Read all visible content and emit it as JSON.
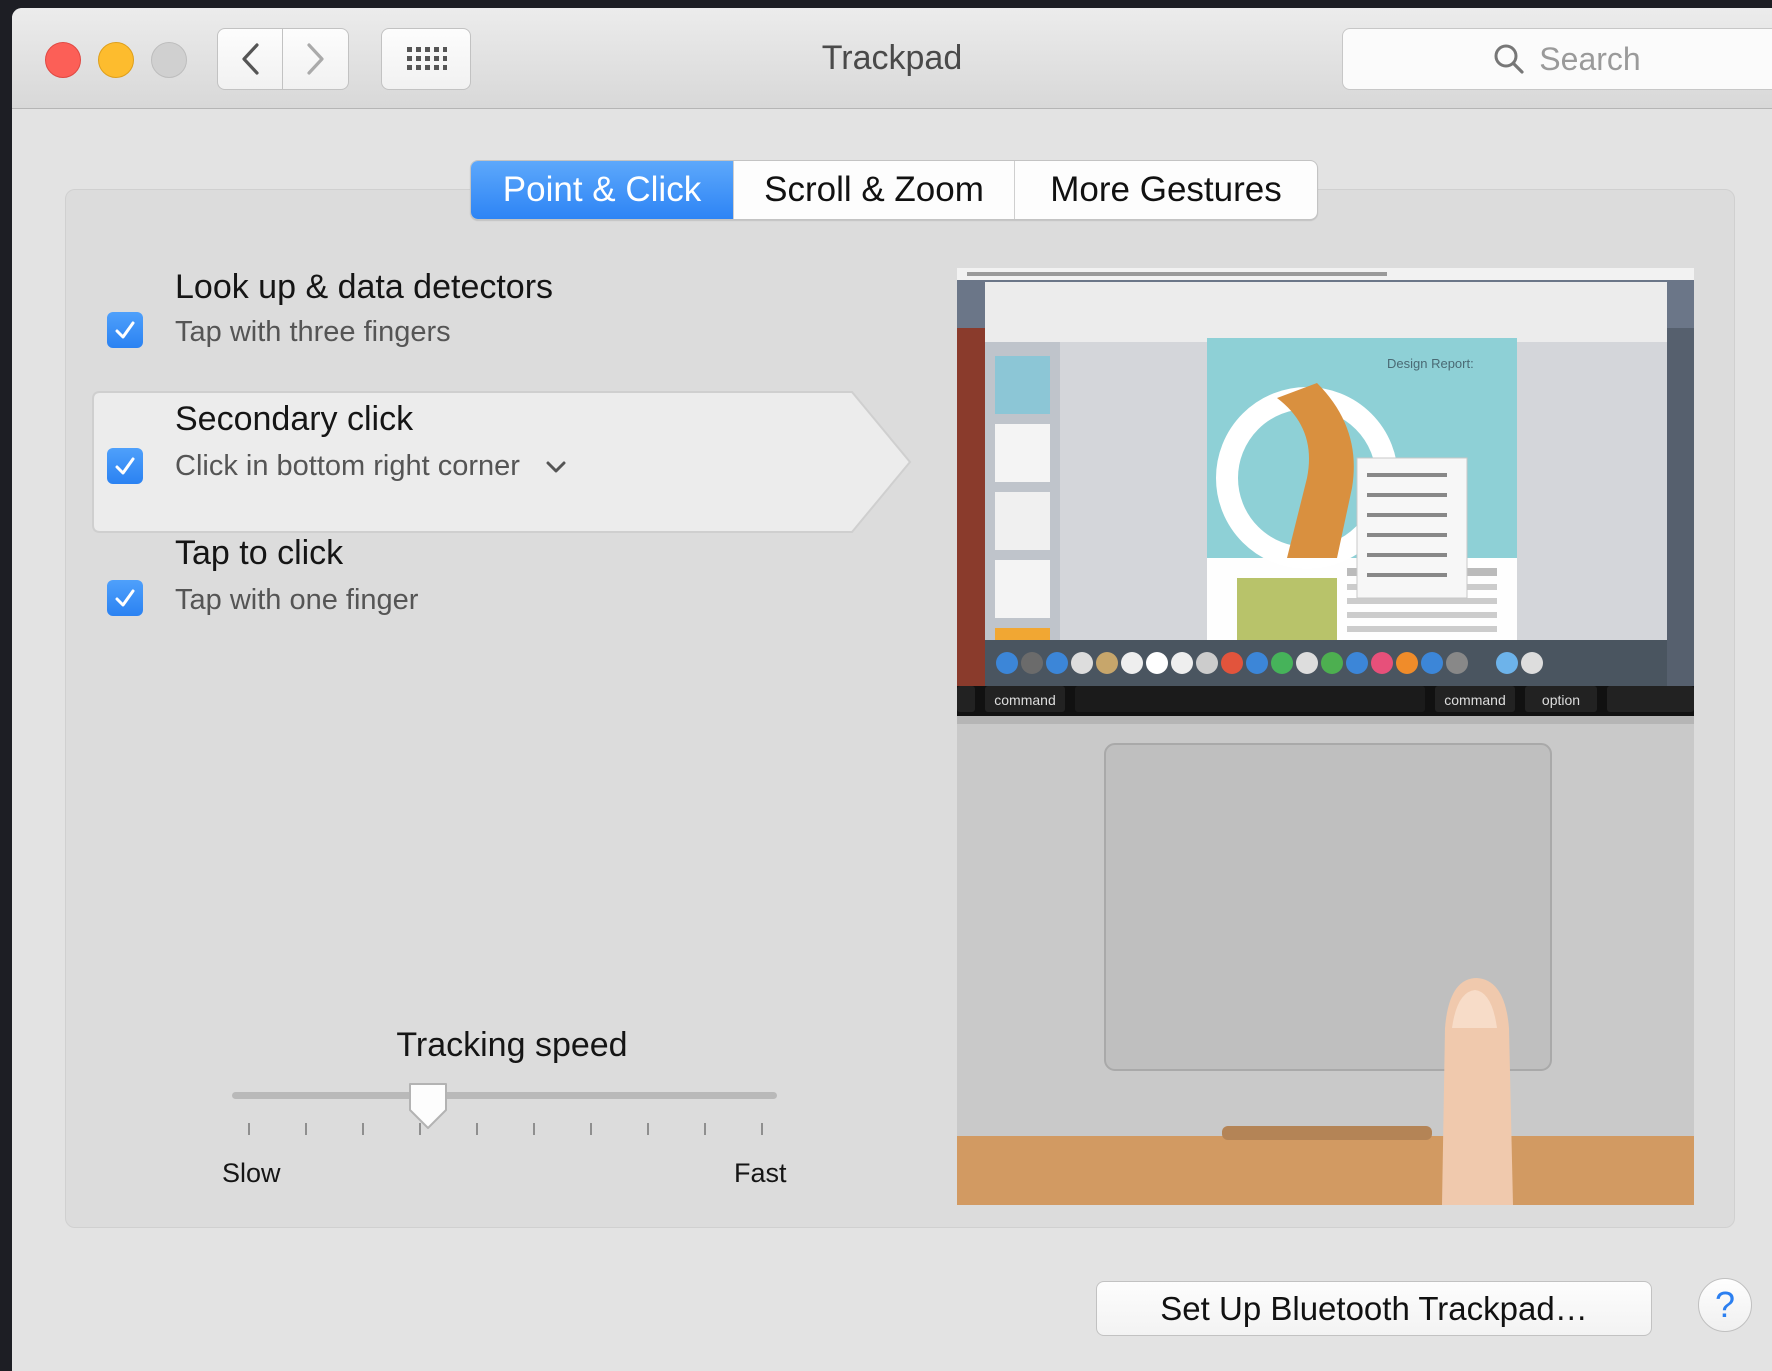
{
  "window": {
    "title": "Trackpad"
  },
  "search": {
    "placeholder": "Search"
  },
  "tabs": [
    {
      "label": "Point & Click",
      "active": true
    },
    {
      "label": "Scroll & Zoom",
      "active": false
    },
    {
      "label": "More Gestures",
      "active": false
    }
  ],
  "options": [
    {
      "title": "Look up & data detectors",
      "subtitle": "Tap with three fingers",
      "checked": true
    },
    {
      "title": "Secondary click",
      "subtitle": "Click in bottom right corner",
      "checked": true
    },
    {
      "title": "Tap to click",
      "subtitle": "Tap with one finger",
      "checked": true
    }
  ],
  "tracking": {
    "label": "Tracking speed",
    "min_label": "Slow",
    "max_label": "Fast",
    "value_fraction": 0.35
  },
  "preview": {
    "key_labels": [
      "command",
      "command",
      "option"
    ],
    "doc_heading": "Design Report:"
  },
  "footer": {
    "bluetooth_button": "Set Up Bluetooth Trackpad…",
    "help_label": "?"
  },
  "colors": {
    "accent": "#2d84f5",
    "close": "#fc5f57",
    "minimize": "#fdbc2e"
  }
}
